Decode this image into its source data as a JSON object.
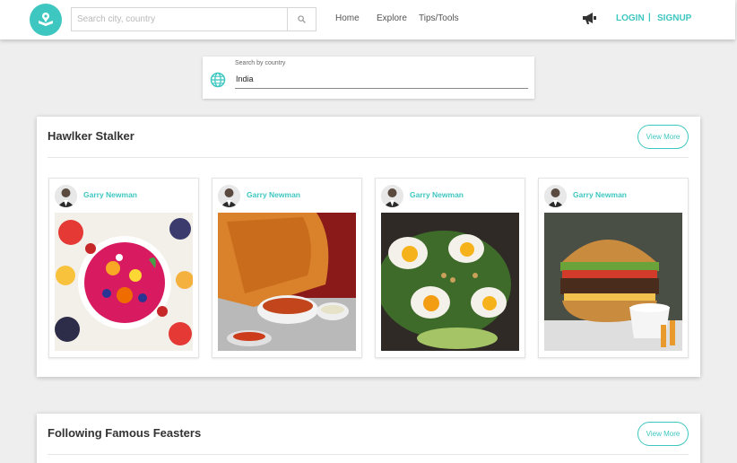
{
  "nav": {
    "search_placeholder": "Search city, country",
    "links": [
      "Home",
      "Explore",
      "Tips/Tools"
    ],
    "login": "LOGIN",
    "separator": "|",
    "signup": "SIGNUP"
  },
  "country_search": {
    "label": "Search by country",
    "value": "India"
  },
  "sections": [
    {
      "title": "Hawlker Stalker",
      "view_more": "View More",
      "cards": [
        {
          "user": "Garry Newman"
        },
        {
          "user": "Garry Newman"
        },
        {
          "user": "Garry Newman"
        },
        {
          "user": "Garry Newman"
        }
      ]
    },
    {
      "title": "Following Famous Feasters",
      "view_more": "View More"
    }
  ],
  "colors": {
    "accent": "#3ec7c1",
    "background": "#eeeeee"
  },
  "icons": [
    "book-location-icon",
    "search-icon",
    "megaphone-icon",
    "globe-icon",
    "user-avatar-icon"
  ]
}
